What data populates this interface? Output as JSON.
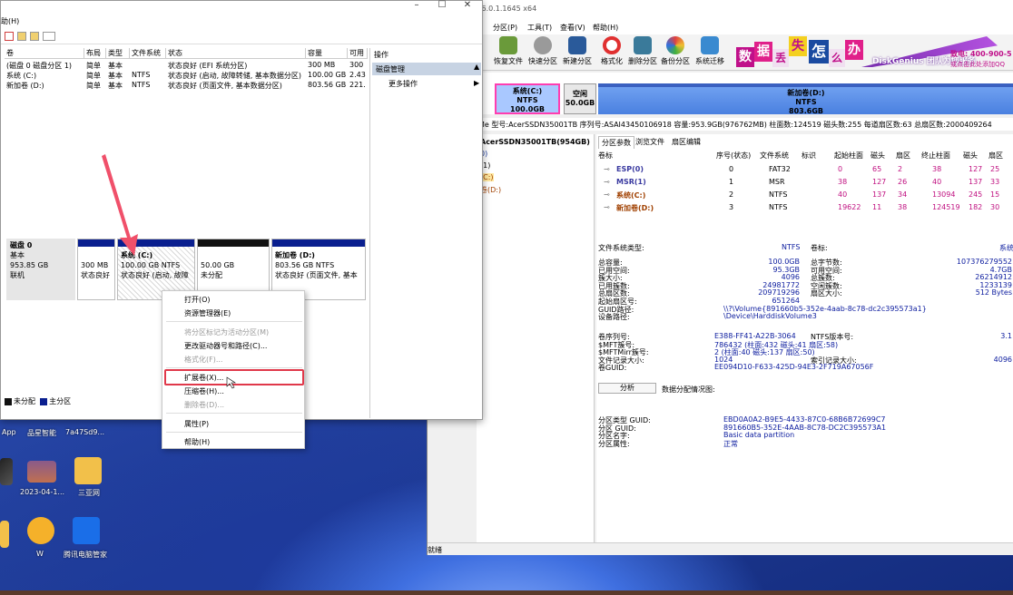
{
  "desktop": {
    "labels": [
      "App",
      "品星智能",
      "7a47Sd9...",
      "2023-04-1...",
      "三亚网",
      "W",
      "腾讯电脑管家"
    ]
  },
  "diskmgmt": {
    "menu_help": "助(H)",
    "columns": [
      "卷",
      "布局",
      "类型",
      "文件系统",
      "状态",
      "容量",
      "可用"
    ],
    "rows": [
      [
        "(磁盘 0 磁盘分区 1)",
        "简单",
        "基本",
        "",
        "状态良好 (EFI 系统分区)",
        "300 MB",
        "300"
      ],
      [
        "系统 (C:)",
        "简单",
        "基本",
        "NTFS",
        "状态良好 (启动, 故障转储, 基本数据分区)",
        "100.00 GB",
        "2.43"
      ],
      [
        "新加卷 (D:)",
        "简单",
        "基本",
        "NTFS",
        "状态良好 (页面文件, 基本数据分区)",
        "803.56 GB",
        "221."
      ]
    ],
    "actions": {
      "header": "操作",
      "selected": "磁盘管理",
      "more": "更多操作"
    },
    "disk": {
      "name": "磁盘 0",
      "type": "基本",
      "size": "953.85 GB",
      "status": "联机"
    },
    "partitions": [
      {
        "title": "",
        "line1": "300 MB",
        "line2": "状态良好"
      },
      {
        "title": "系统  (C:)",
        "line1": "100.00 GB NTFS",
        "line2": "状态良好 (启动, 故障"
      },
      {
        "title": "",
        "line1": "50.00 GB",
        "line2": "未分配"
      },
      {
        "title": "新加卷  (D:)",
        "line1": "803.56 GB NTFS",
        "line2": "状态良好 (页面文件, 基本"
      }
    ],
    "legend": {
      "unallocated": "未分配",
      "primary": "主分区"
    }
  },
  "context_menu": {
    "open": "打开(O)",
    "explorer": "资源管理器(E)",
    "mark_active": "将分区标记为活动分区(M)",
    "change_letter": "更改驱动器号和路径(C)...",
    "format": "格式化(F)...",
    "extend": "扩展卷(X)...",
    "shrink": "压缩卷(H)...",
    "delete": "删除卷(D)...",
    "properties": "属性(P)",
    "help": "帮助(H)"
  },
  "diskgenius": {
    "title": "V6.0.1.1645 x64",
    "menu": [
      "分区(P)",
      "工具(T)",
      "查看(V)",
      "帮助(H)"
    ],
    "toolbar": [
      "恢复文件",
      "快速分区",
      "新建分区",
      "格式化",
      "删除分区",
      "备份分区",
      "系统迁移"
    ],
    "banner": {
      "chars": [
        "数",
        "据",
        "丢",
        "失",
        "怎",
        "么",
        "办"
      ],
      "brand": "DiskGenius 团队为您服务",
      "phone": "致电: 400-900-5",
      "qq": "或点击此处添加QQ"
    },
    "segments": [
      {
        "name": "系统(C:)",
        "fs": "NTFS",
        "size": "100.0GB"
      },
      {
        "name": "空闲",
        "fs": "",
        "size": "50.0GB"
      },
      {
        "name": "新加卷(D:)",
        "fs": "NTFS",
        "size": "803.6GB"
      }
    ],
    "infoline": "型号:AcerSSDN35001TB  序列号:ASAI43450106918  容量:953.9GB(976762MB)  柱面数:124519  磁头数:255  每道扇区数:63  总扇区数:2000409264",
    "infoline_prefix": "Me",
    "tree": [
      "AcerSSDN35001TB(954GB)",
      "0)",
      "(1)",
      "(C:)",
      "卷(D:)"
    ],
    "tabs": [
      "分区参数",
      "浏览文件",
      "扇区编辑"
    ],
    "pt_columns": [
      "卷标",
      "序号(状态)",
      "文件系统",
      "标识",
      "起始柱面",
      "磁头",
      "扇区",
      "终止柱面",
      "磁头",
      "扇区"
    ],
    "pt_rows": [
      [
        "ESP(0)",
        "0",
        "FAT32",
        "",
        "0",
        "65",
        "2",
        "38",
        "127",
        "25"
      ],
      [
        "MSR(1)",
        "1",
        "MSR",
        "",
        "38",
        "127",
        "26",
        "40",
        "137",
        "33"
      ],
      [
        "系统(C:)",
        "2",
        "NTFS",
        "",
        "40",
        "137",
        "34",
        "13094",
        "245",
        "15"
      ],
      [
        "新加卷(D:)",
        "3",
        "NTFS",
        "",
        "19622",
        "11",
        "38",
        "124519",
        "182",
        "30"
      ]
    ],
    "fs": {
      "type_label": "文件系统类型:",
      "type_value": "NTFS",
      "vol_label": "卷标:",
      "vol_value": "系统",
      "left": [
        [
          "总容量:",
          "100.0GB"
        ],
        [
          "已用空间:",
          "95.3GB"
        ],
        [
          "簇大小:",
          "4096"
        ],
        [
          "已用簇数:",
          "24981772"
        ],
        [
          "总扇区数:",
          "209719296"
        ],
        [
          "起始扇区号:",
          "651264"
        ],
        [
          "GUID路径:",
          "\\\\?\\Volume{891660b5-352e-4aab-8c78-dc2c395573a1}"
        ],
        [
          "设备路径:",
          "\\Device\\HarddiskVolume3"
        ]
      ],
      "right": [
        [
          "总字节数:",
          "107376279552"
        ],
        [
          "可用空间:",
          "4.7GB"
        ],
        [
          "总簇数:",
          "26214912"
        ],
        [
          "空闲簇数:",
          "1233139"
        ],
        [
          "扇区大小:",
          "512 Bytes"
        ]
      ],
      "ntfs_left": [
        [
          "卷序列号:",
          "E388-FF41-A22B-3064"
        ],
        [
          "$MFT簇号:",
          "786432 (柱面:432 磁头:41 扇区:58)"
        ],
        [
          "$MFTMirr簇号:",
          "2 (柱面:40 磁头:137 扇区:50)"
        ],
        [
          "文件记录大小:",
          "1024"
        ],
        [
          "卷GUID:",
          "EE094D10-F633-425D-94E3-2F719A67056F"
        ]
      ],
      "ntfs_right": [
        [
          "NTFS版本号:",
          "3.1"
        ],
        [
          "索引记录大小:",
          "4096"
        ]
      ],
      "analyze": "分析",
      "dist": "数据分配情况图:",
      "guid": [
        [
          "分区类型 GUID:",
          "EBD0A0A2-B9E5-4433-87C0-68B6B72699C7"
        ],
        [
          "分区 GUID:",
          "891660B5-352E-4AAB-8C78-DC2C395573A1"
        ],
        [
          "分区名字:",
          "Basic data partition"
        ],
        [
          "分区属性:",
          "正常"
        ]
      ]
    },
    "status": "就绪"
  },
  "colors": {
    "primary": "#0a1f8f",
    "unalloc": "#111111",
    "highlight": "#e0384a",
    "free": "#1a2a8a",
    "selected": "#ff3db0"
  }
}
